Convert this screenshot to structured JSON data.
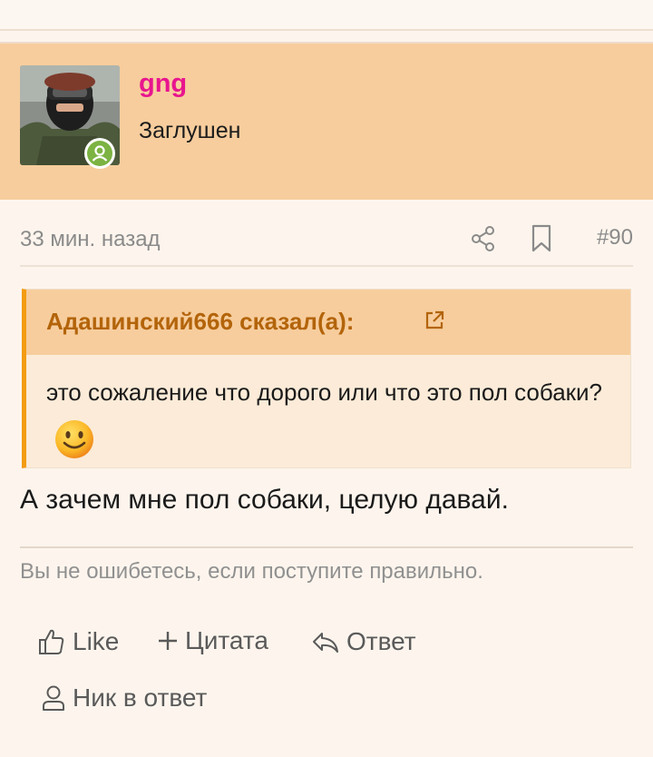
{
  "user": {
    "name": "gng",
    "title": "Заглушен",
    "status_color": "#7cb342"
  },
  "post": {
    "time": "33 мин. назад",
    "number": "#90",
    "icons": [
      "share-icon",
      "bookmark-icon"
    ]
  },
  "quote": {
    "author": "Адашинский666 сказал(а):",
    "text": "это сожаление что дорого или что это пол собаки?",
    "emoji": "slightly-smiling-face"
  },
  "message": "А зачем мне пол собаки, целую давай.",
  "signature": "Вы не ошибетесь, если поступите правильно.",
  "actions": {
    "like": "Like",
    "quote": "Цитата",
    "reply": "Ответ",
    "mention": "Ник в ответ"
  },
  "colors": {
    "accent_band": "#f7cd9d",
    "username": "#e8158e",
    "quote_border": "#f39c12",
    "quote_author": "#b3640a"
  }
}
